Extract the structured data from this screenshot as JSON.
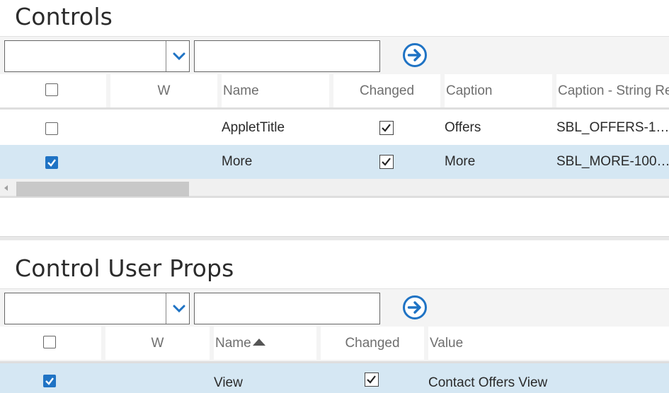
{
  "controls": {
    "title": "Controls",
    "query": {
      "select_value": "",
      "text_value": ""
    },
    "columns": {
      "w": "W",
      "name": "Name",
      "changed": "Changed",
      "caption": "Caption",
      "caption_string_ref": "Caption - String Re"
    },
    "rows": [
      {
        "selected": false,
        "w": "",
        "name": "AppletTitle",
        "changed": true,
        "caption": "Offers",
        "caption_string_ref": "SBL_OFFERS-1…"
      },
      {
        "selected": true,
        "w": "",
        "name": "More",
        "changed": true,
        "caption": "More",
        "caption_string_ref": "SBL_MORE-100…"
      }
    ],
    "scroll_position": 0.0
  },
  "user_props": {
    "title": "Control User Props",
    "query": {
      "select_value": "",
      "text_value": ""
    },
    "columns": {
      "w": "W",
      "name": "Name",
      "changed": "Changed",
      "value": "Value"
    },
    "sort": {
      "column": "Name",
      "direction": "ascending"
    },
    "rows": [
      {
        "selected": true,
        "w": "",
        "name": "View",
        "changed": true,
        "value": "Contact Offers View"
      }
    ]
  },
  "colors": {
    "accent": "#1f73c4",
    "selected_row": "#d5e7f3",
    "header_bg": "#f4f4f4"
  }
}
